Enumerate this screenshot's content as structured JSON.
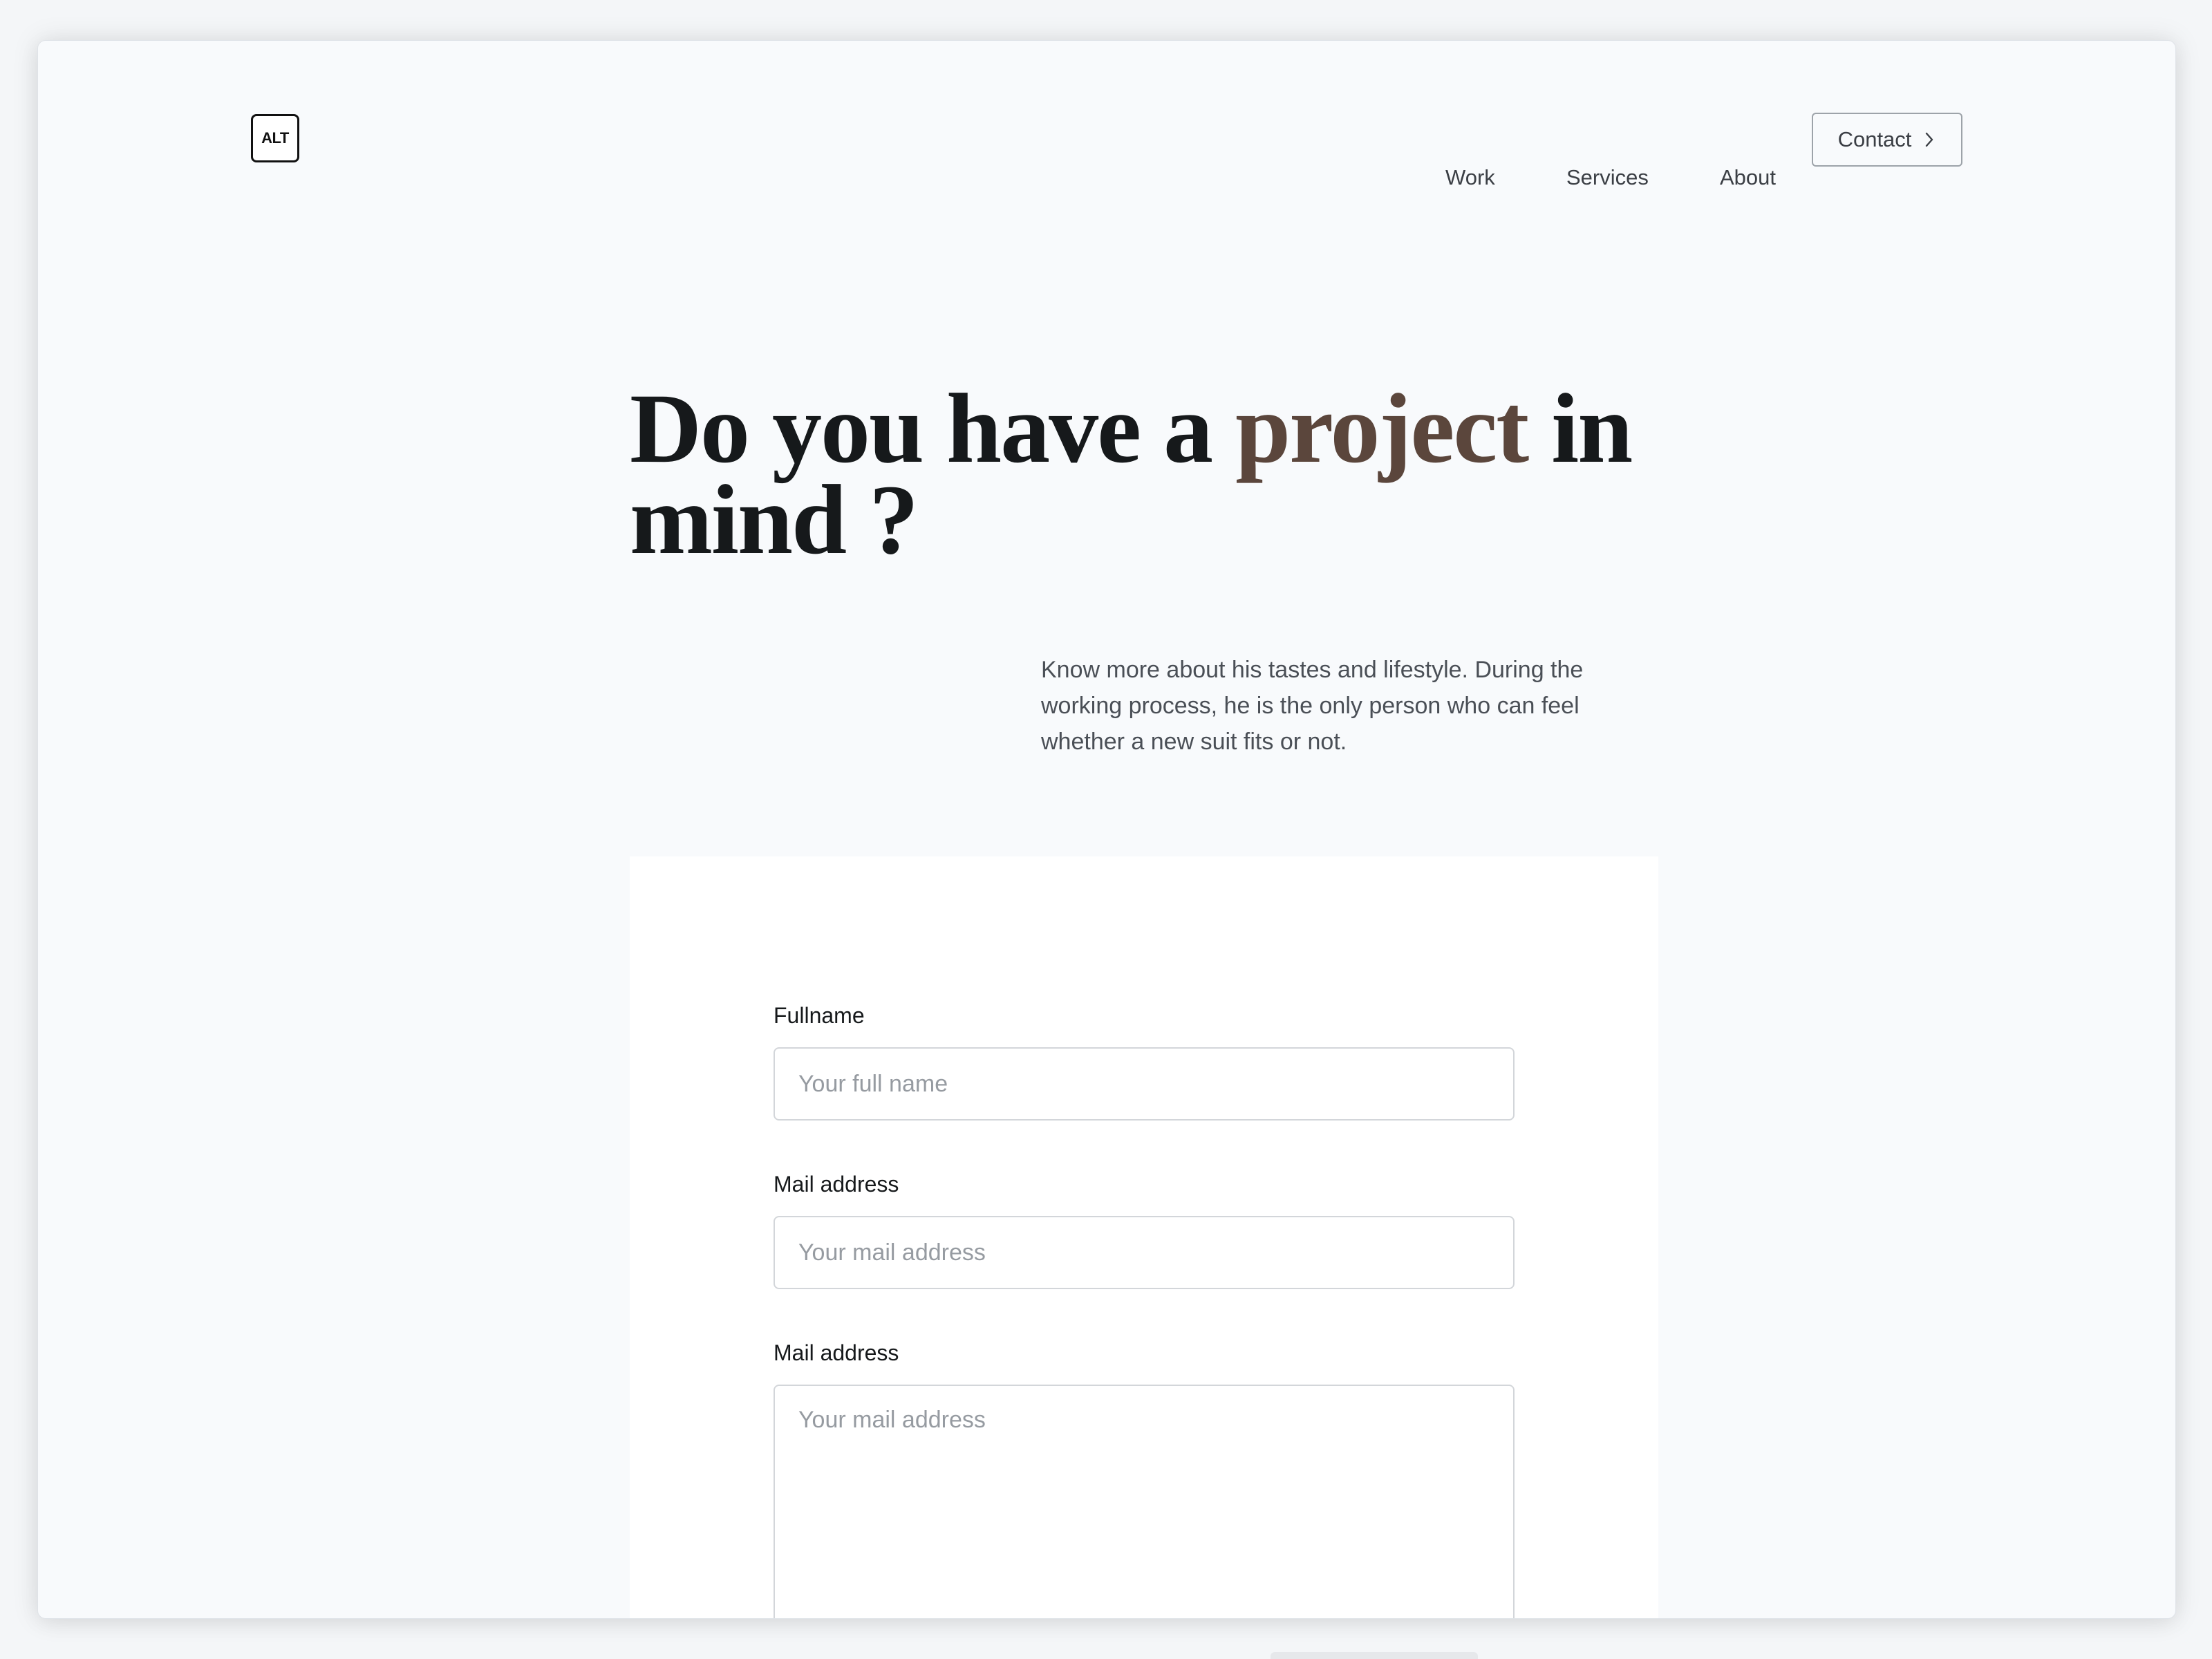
{
  "header": {
    "logo_text": "ALT",
    "nav": [
      {
        "label": "Work"
      },
      {
        "label": "Services"
      },
      {
        "label": "About"
      }
    ],
    "contact_label": "Contact",
    "contact_icon": "chevron-right-icon"
  },
  "hero": {
    "title_part1": "Do you have a ",
    "title_accent": "project",
    "title_part2": " in mind ?",
    "description": "Know more about his tastes and lifestyle. During the working process, he is the only person who can feel whether a new suit fits or not."
  },
  "form": {
    "fields": [
      {
        "label": "Fullname",
        "placeholder": "Your full name",
        "value": ""
      },
      {
        "label": "Mail address",
        "placeholder": "Your mail address",
        "value": ""
      },
      {
        "label": "Mail address",
        "placeholder": "Your mail address",
        "value": ""
      }
    ]
  },
  "colors": {
    "accent": "#5b463c",
    "text_dark": "#16191b",
    "background": "#f8fafc"
  }
}
